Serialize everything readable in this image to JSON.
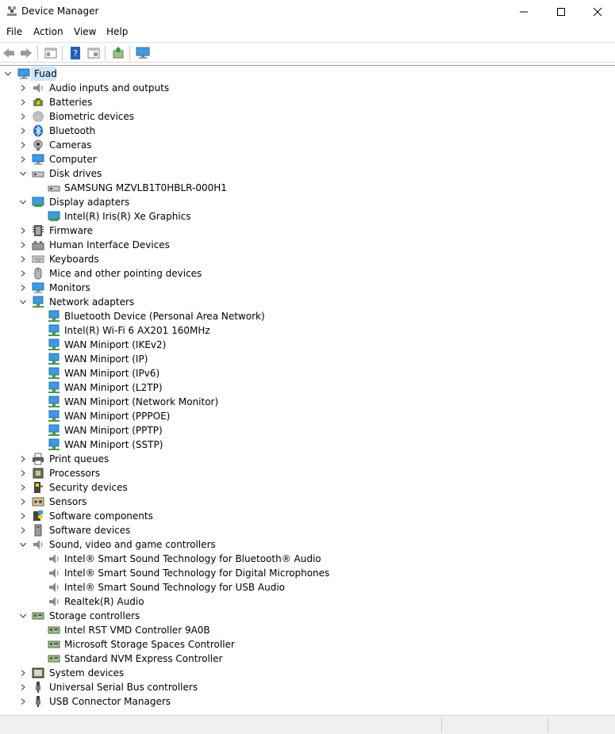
{
  "window": {
    "title": "Device Manager",
    "controls": {
      "minimize": "minimize",
      "maximize": "maximize",
      "close": "close"
    }
  },
  "menu": [
    "File",
    "Action",
    "View",
    "Help"
  ],
  "toolbar": {
    "buttons": [
      "back-arrow-icon",
      "forward-arrow-icon",
      "properties-pane-icon",
      "help-icon",
      "show-hide-icon",
      "update-driver-icon",
      "monitor-scan-icon"
    ]
  },
  "tree": {
    "root": "Fuad",
    "categories": [
      {
        "label": "Audio inputs and outputs",
        "icon": "speaker-icon",
        "expanded": false,
        "children": []
      },
      {
        "label": "Batteries",
        "icon": "battery-icon",
        "expanded": false,
        "children": []
      },
      {
        "label": "Biometric devices",
        "icon": "fingerprint-icon",
        "expanded": false,
        "children": []
      },
      {
        "label": "Bluetooth",
        "icon": "bluetooth-icon",
        "expanded": false,
        "children": []
      },
      {
        "label": "Cameras",
        "icon": "camera-icon",
        "expanded": false,
        "children": []
      },
      {
        "label": "Computer",
        "icon": "computer-icon",
        "expanded": false,
        "children": []
      },
      {
        "label": "Disk drives",
        "icon": "disk-icon",
        "expanded": true,
        "children": [
          {
            "label": "SAMSUNG MZVLB1T0HBLR-000H1",
            "icon": "disk-icon"
          }
        ]
      },
      {
        "label": "Display adapters",
        "icon": "display-adapter-icon",
        "expanded": true,
        "children": [
          {
            "label": "Intel(R) Iris(R) Xe Graphics",
            "icon": "display-adapter-icon"
          }
        ]
      },
      {
        "label": "Firmware",
        "icon": "firmware-icon",
        "expanded": false,
        "children": []
      },
      {
        "label": "Human Interface Devices",
        "icon": "hid-icon",
        "expanded": false,
        "children": []
      },
      {
        "label": "Keyboards",
        "icon": "keyboard-icon",
        "expanded": false,
        "children": []
      },
      {
        "label": "Mice and other pointing devices",
        "icon": "mouse-icon",
        "expanded": false,
        "children": []
      },
      {
        "label": "Monitors",
        "icon": "monitor-icon",
        "expanded": false,
        "children": []
      },
      {
        "label": "Network adapters",
        "icon": "network-icon",
        "expanded": true,
        "children": [
          {
            "label": "Bluetooth Device (Personal Area Network)",
            "icon": "network-icon"
          },
          {
            "label": "Intel(R) Wi-Fi 6 AX201 160MHz",
            "icon": "network-icon"
          },
          {
            "label": "WAN Miniport (IKEv2)",
            "icon": "network-icon"
          },
          {
            "label": "WAN Miniport (IP)",
            "icon": "network-icon"
          },
          {
            "label": "WAN Miniport (IPv6)",
            "icon": "network-icon"
          },
          {
            "label": "WAN Miniport (L2TP)",
            "icon": "network-icon"
          },
          {
            "label": "WAN Miniport (Network Monitor)",
            "icon": "network-icon"
          },
          {
            "label": "WAN Miniport (PPPOE)",
            "icon": "network-icon"
          },
          {
            "label": "WAN Miniport (PPTP)",
            "icon": "network-icon"
          },
          {
            "label": "WAN Miniport (SSTP)",
            "icon": "network-icon"
          }
        ]
      },
      {
        "label": "Print queues",
        "icon": "printer-icon",
        "expanded": false,
        "children": []
      },
      {
        "label": "Processors",
        "icon": "processor-icon",
        "expanded": false,
        "children": []
      },
      {
        "label": "Security devices",
        "icon": "security-icon",
        "expanded": false,
        "children": []
      },
      {
        "label": "Sensors",
        "icon": "sensor-icon",
        "expanded": false,
        "children": []
      },
      {
        "label": "Software components",
        "icon": "software-component-icon",
        "expanded": false,
        "children": []
      },
      {
        "label": "Software devices",
        "icon": "software-device-icon",
        "expanded": false,
        "children": []
      },
      {
        "label": "Sound, video and game controllers",
        "icon": "speaker-icon",
        "expanded": true,
        "children": [
          {
            "label": "Intel® Smart Sound Technology for Bluetooth® Audio",
            "icon": "speaker-icon"
          },
          {
            "label": "Intel® Smart Sound Technology for Digital Microphones",
            "icon": "speaker-icon"
          },
          {
            "label": "Intel® Smart Sound Technology for USB Audio",
            "icon": "speaker-icon"
          },
          {
            "label": "Realtek(R) Audio",
            "icon": "speaker-icon"
          }
        ]
      },
      {
        "label": "Storage controllers",
        "icon": "storage-controller-icon",
        "expanded": true,
        "children": [
          {
            "label": "Intel RST VMD Controller 9A0B",
            "icon": "storage-controller-icon"
          },
          {
            "label": "Microsoft Storage Spaces Controller",
            "icon": "storage-controller-icon"
          },
          {
            "label": "Standard NVM Express Controller",
            "icon": "storage-controller-icon"
          }
        ]
      },
      {
        "label": "System devices",
        "icon": "system-device-icon",
        "expanded": false,
        "children": []
      },
      {
        "label": "Universal Serial Bus controllers",
        "icon": "usb-icon",
        "expanded": false,
        "children": []
      },
      {
        "label": "USB Connector Managers",
        "icon": "usb-icon",
        "expanded": false,
        "children": []
      }
    ]
  },
  "colors": {
    "selection": "#cce8ff",
    "accent_blue": "#1f6fd1",
    "monitor_blue": "#3c9be3"
  }
}
